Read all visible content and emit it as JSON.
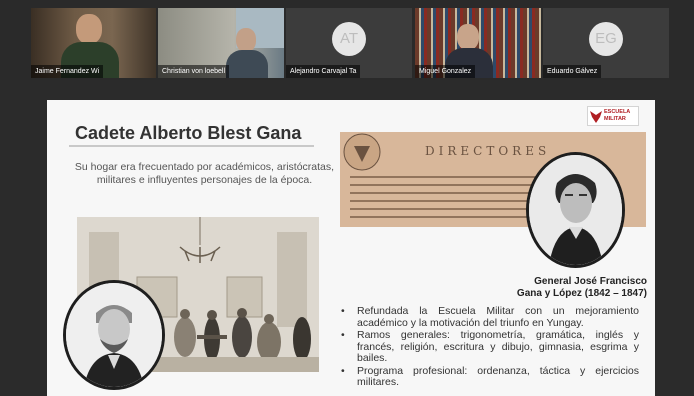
{
  "participants": [
    {
      "name": "Jaime Fernandez Wi",
      "video": true
    },
    {
      "name": "Christian von loebell",
      "video": true
    },
    {
      "name": "Alejandro Carvajal Ta",
      "initials": "AT",
      "video": false
    },
    {
      "name": "Miguel Gonzalez",
      "video": true
    },
    {
      "name": "Eduardo Gálvez",
      "initials": "EG",
      "video": false
    }
  ],
  "slide": {
    "title": "Cadete Alberto Blest Gana",
    "subtitle": "Su hogar era frecuentado por académicos, aristócratas, militares e influyentes personajes de la época.",
    "logo_text_1": "ESCUELA",
    "logo_text_2": "MILITAR",
    "directory_heading": "DIRECTORES",
    "caption_line1": "General José Francisco",
    "caption_line2": "Gana y López (1842 – 1847)",
    "bullets": [
      "Refundada la Escuela Militar con un mejoramiento académico y la motivación del triunfo en Yungay.",
      "Ramos generales: trigonometría, gramática, inglés y francés, religión, escritura y dibujo, gimnasia, esgrima y bailes.",
      "Programa profesional: ordenanza, táctica y ejercicios militares."
    ]
  },
  "colors": {
    "accent_red": "#b01e23",
    "slide_bg": "#f7f7f7",
    "app_bg": "#2b2b2b"
  }
}
